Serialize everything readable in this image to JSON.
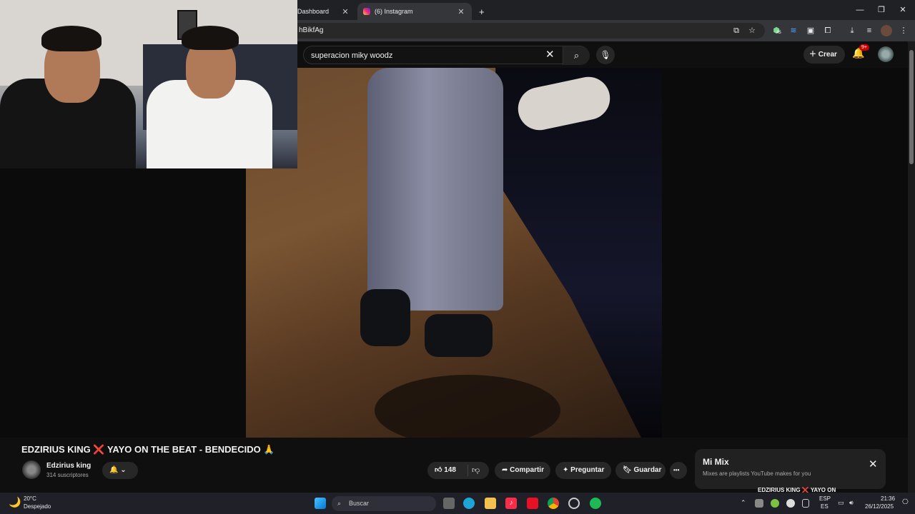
{
  "browser": {
    "tabs": [
      {
        "label": "Dashboard",
        "active": false
      },
      {
        "label": "(6) Instagram",
        "active": true
      }
    ],
    "close_glyph": "✕",
    "new_tab_glyph": "+",
    "url_fragment": "hBikfAg",
    "window_controls": {
      "minimize": "—",
      "restore": "❐",
      "close": "✕"
    },
    "extension_badge": "45"
  },
  "youtube": {
    "search_query": "superacion miky woodz",
    "create_label": "Crear",
    "notification_badge": "9+",
    "video": {
      "title": "EDZIRIUS KING ❌ YAYO ON THE BEAT - BENDECIDO 🙏",
      "channel_name": "Edzirius king",
      "subscribers": "314 suscriptores",
      "likes": "148",
      "actions": {
        "share": "Compartir",
        "ask": "Preguntar",
        "save": "Guardar",
        "more": "•••"
      }
    },
    "mix": {
      "title": "Mi Mix",
      "subtitle": "Mixes are playlists YouTube makes for you",
      "next_item": "EDZIRIUS KING ❌ YAYO ON"
    }
  },
  "taskbar": {
    "weather_temp": "20°C",
    "weather_desc": "Despejado",
    "search_placeholder": "Buscar",
    "lang_top": "ESP",
    "lang_bottom": "ES",
    "time": "21:36",
    "date": "26/12/2025"
  },
  "colors": {
    "background": "#0f0f0f",
    "accent_red": "#cc0000",
    "chrome_dark": "#202124"
  }
}
